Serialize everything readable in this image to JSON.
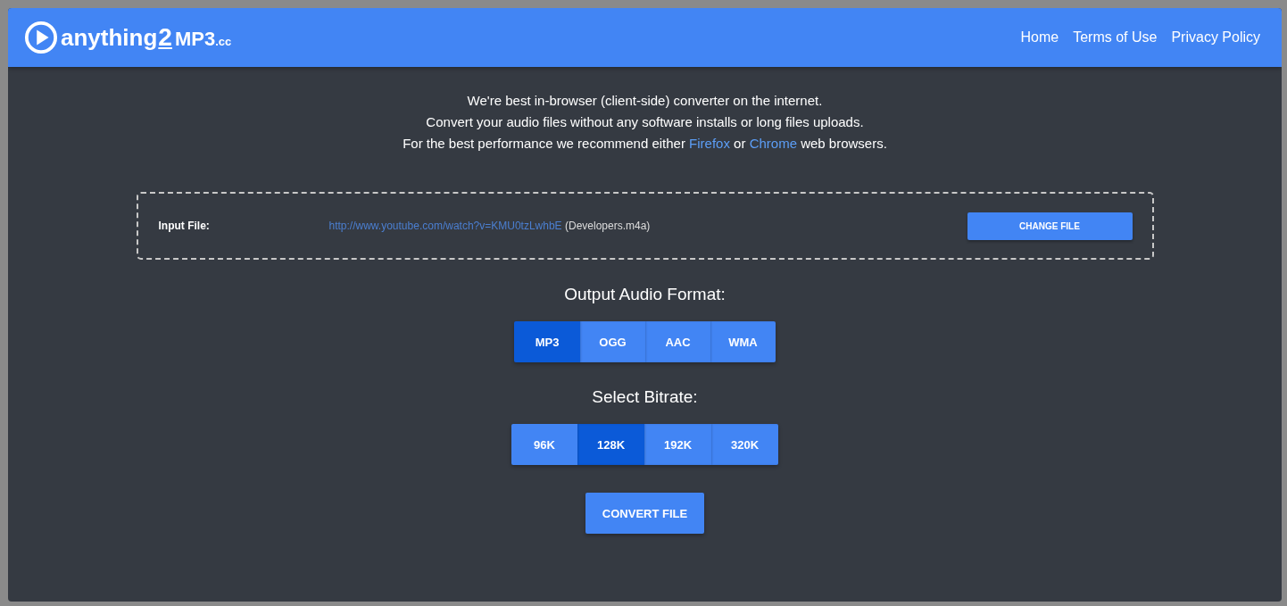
{
  "logo": {
    "name": "anything",
    "number": "2",
    "format": "MP3",
    "tld": ".cc"
  },
  "nav": [
    {
      "label": "Home"
    },
    {
      "label": "Terms of Use"
    },
    {
      "label": "Privacy Policy"
    }
  ],
  "intro": {
    "lines": [
      "We're best in-browser (client-side) converter on the internet.",
      "Convert your audio files without any software installs or long files uploads."
    ],
    "recommend": {
      "before": "For the best performance we recommend either",
      "link_a": "Firefox",
      "middle": "or",
      "link_b": "Chrome",
      "after": "web browsers."
    }
  },
  "input_file": {
    "label": "Input File:",
    "url": "http://www.youtube.com/watch?v=KMU0tzLwhbE",
    "filename": "(Developers.m4a)",
    "button": "CHANGE FILE"
  },
  "format": {
    "title": "Output Audio Format:",
    "options": [
      {
        "label": "MP3",
        "selected": true
      },
      {
        "label": "OGG",
        "selected": false
      },
      {
        "label": "AAC",
        "selected": false
      },
      {
        "label": "WMA",
        "selected": false
      }
    ]
  },
  "bitrate": {
    "title": "Select Bitrate:",
    "options": [
      {
        "label": "96K",
        "selected": false
      },
      {
        "label": "128K",
        "selected": true
      },
      {
        "label": "192K",
        "selected": false
      },
      {
        "label": "320K",
        "selected": false
      }
    ]
  },
  "convert_button": "CONVERT FILE"
}
